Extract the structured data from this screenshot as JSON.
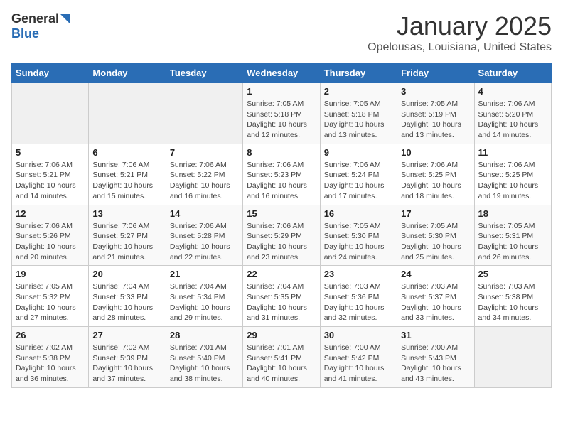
{
  "header": {
    "logo_general": "General",
    "logo_blue": "Blue",
    "title": "January 2025",
    "subtitle": "Opelousas, Louisiana, United States"
  },
  "weekdays": [
    "Sunday",
    "Monday",
    "Tuesday",
    "Wednesday",
    "Thursday",
    "Friday",
    "Saturday"
  ],
  "weeks": [
    [
      {
        "day": "",
        "info": ""
      },
      {
        "day": "",
        "info": ""
      },
      {
        "day": "",
        "info": ""
      },
      {
        "day": "1",
        "info": "Sunrise: 7:05 AM\nSunset: 5:18 PM\nDaylight: 10 hours\nand 12 minutes."
      },
      {
        "day": "2",
        "info": "Sunrise: 7:05 AM\nSunset: 5:18 PM\nDaylight: 10 hours\nand 13 minutes."
      },
      {
        "day": "3",
        "info": "Sunrise: 7:05 AM\nSunset: 5:19 PM\nDaylight: 10 hours\nand 13 minutes."
      },
      {
        "day": "4",
        "info": "Sunrise: 7:06 AM\nSunset: 5:20 PM\nDaylight: 10 hours\nand 14 minutes."
      }
    ],
    [
      {
        "day": "5",
        "info": "Sunrise: 7:06 AM\nSunset: 5:21 PM\nDaylight: 10 hours\nand 14 minutes."
      },
      {
        "day": "6",
        "info": "Sunrise: 7:06 AM\nSunset: 5:21 PM\nDaylight: 10 hours\nand 15 minutes."
      },
      {
        "day": "7",
        "info": "Sunrise: 7:06 AM\nSunset: 5:22 PM\nDaylight: 10 hours\nand 16 minutes."
      },
      {
        "day": "8",
        "info": "Sunrise: 7:06 AM\nSunset: 5:23 PM\nDaylight: 10 hours\nand 16 minutes."
      },
      {
        "day": "9",
        "info": "Sunrise: 7:06 AM\nSunset: 5:24 PM\nDaylight: 10 hours\nand 17 minutes."
      },
      {
        "day": "10",
        "info": "Sunrise: 7:06 AM\nSunset: 5:25 PM\nDaylight: 10 hours\nand 18 minutes."
      },
      {
        "day": "11",
        "info": "Sunrise: 7:06 AM\nSunset: 5:25 PM\nDaylight: 10 hours\nand 19 minutes."
      }
    ],
    [
      {
        "day": "12",
        "info": "Sunrise: 7:06 AM\nSunset: 5:26 PM\nDaylight: 10 hours\nand 20 minutes."
      },
      {
        "day": "13",
        "info": "Sunrise: 7:06 AM\nSunset: 5:27 PM\nDaylight: 10 hours\nand 21 minutes."
      },
      {
        "day": "14",
        "info": "Sunrise: 7:06 AM\nSunset: 5:28 PM\nDaylight: 10 hours\nand 22 minutes."
      },
      {
        "day": "15",
        "info": "Sunrise: 7:06 AM\nSunset: 5:29 PM\nDaylight: 10 hours\nand 23 minutes."
      },
      {
        "day": "16",
        "info": "Sunrise: 7:05 AM\nSunset: 5:30 PM\nDaylight: 10 hours\nand 24 minutes."
      },
      {
        "day": "17",
        "info": "Sunrise: 7:05 AM\nSunset: 5:30 PM\nDaylight: 10 hours\nand 25 minutes."
      },
      {
        "day": "18",
        "info": "Sunrise: 7:05 AM\nSunset: 5:31 PM\nDaylight: 10 hours\nand 26 minutes."
      }
    ],
    [
      {
        "day": "19",
        "info": "Sunrise: 7:05 AM\nSunset: 5:32 PM\nDaylight: 10 hours\nand 27 minutes."
      },
      {
        "day": "20",
        "info": "Sunrise: 7:04 AM\nSunset: 5:33 PM\nDaylight: 10 hours\nand 28 minutes."
      },
      {
        "day": "21",
        "info": "Sunrise: 7:04 AM\nSunset: 5:34 PM\nDaylight: 10 hours\nand 29 minutes."
      },
      {
        "day": "22",
        "info": "Sunrise: 7:04 AM\nSunset: 5:35 PM\nDaylight: 10 hours\nand 31 minutes."
      },
      {
        "day": "23",
        "info": "Sunrise: 7:03 AM\nSunset: 5:36 PM\nDaylight: 10 hours\nand 32 minutes."
      },
      {
        "day": "24",
        "info": "Sunrise: 7:03 AM\nSunset: 5:37 PM\nDaylight: 10 hours\nand 33 minutes."
      },
      {
        "day": "25",
        "info": "Sunrise: 7:03 AM\nSunset: 5:38 PM\nDaylight: 10 hours\nand 34 minutes."
      }
    ],
    [
      {
        "day": "26",
        "info": "Sunrise: 7:02 AM\nSunset: 5:38 PM\nDaylight: 10 hours\nand 36 minutes."
      },
      {
        "day": "27",
        "info": "Sunrise: 7:02 AM\nSunset: 5:39 PM\nDaylight: 10 hours\nand 37 minutes."
      },
      {
        "day": "28",
        "info": "Sunrise: 7:01 AM\nSunset: 5:40 PM\nDaylight: 10 hours\nand 38 minutes."
      },
      {
        "day": "29",
        "info": "Sunrise: 7:01 AM\nSunset: 5:41 PM\nDaylight: 10 hours\nand 40 minutes."
      },
      {
        "day": "30",
        "info": "Sunrise: 7:00 AM\nSunset: 5:42 PM\nDaylight: 10 hours\nand 41 minutes."
      },
      {
        "day": "31",
        "info": "Sunrise: 7:00 AM\nSunset: 5:43 PM\nDaylight: 10 hours\nand 43 minutes."
      },
      {
        "day": "",
        "info": ""
      }
    ]
  ]
}
